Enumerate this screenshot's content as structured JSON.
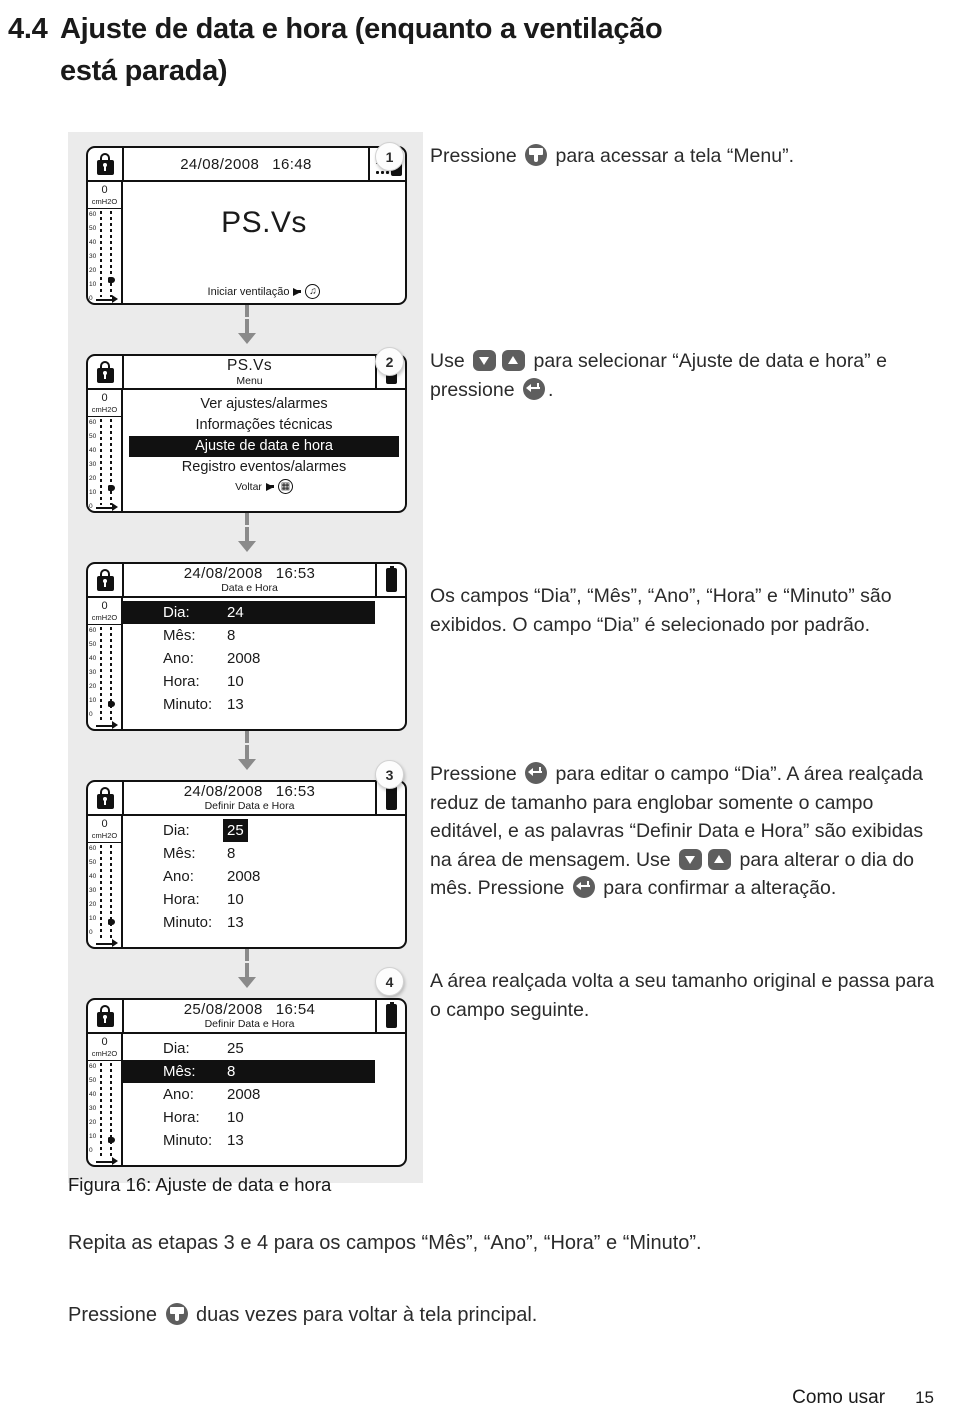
{
  "heading": {
    "section_number": "4.4",
    "line1": "Ajuste de data e hora (enquanto a ventilação",
    "line2": "está parada)"
  },
  "device_common": {
    "lock_icon": "lock-icon",
    "scale_zero": "0",
    "scale_unit": "cmH2O",
    "scale_ticks": [
      "60",
      "50",
      "40",
      "30",
      "20",
      "10",
      "0"
    ],
    "battery_icon": "battery-icon",
    "alarm_icon": "alarm-silence-icon"
  },
  "screens": [
    {
      "id": "screen-home",
      "header_datetime": "24/08/2008",
      "header_time": "16:48",
      "mode_label": "PS.Vs",
      "footer_hint": "Iniciar ventilação",
      "footer_icon": "start-ventilation-icon"
    },
    {
      "id": "screen-menu",
      "title": "PS.Vs",
      "subtitle": "Menu",
      "items": [
        {
          "label": "Ver ajustes/alarmes",
          "selected": false
        },
        {
          "label": "Informações técnicas",
          "selected": false
        },
        {
          "label": "Ajuste de data e hora",
          "selected": true
        },
        {
          "label": "Registro eventos/alarmes",
          "selected": false
        }
      ],
      "footer_hint": "Voltar",
      "footer_icon": "menu-key-icon"
    },
    {
      "id": "screen-data-hora",
      "header_datetime": "24/08/2008",
      "header_time": "16:53",
      "subtitle": "Data e Hora",
      "fields": [
        {
          "label": "Dia:",
          "value": "24",
          "highlight": "row"
        },
        {
          "label": "Mês:",
          "value": "8",
          "highlight": "none"
        },
        {
          "label": "Ano:",
          "value": "2008",
          "highlight": "none"
        },
        {
          "label": "Hora:",
          "value": "10",
          "highlight": "none"
        },
        {
          "label": "Minuto:",
          "value": "13",
          "highlight": "none"
        }
      ]
    },
    {
      "id": "screen-definir-dia",
      "header_datetime": "24/08/2008",
      "header_time": "16:53",
      "subtitle": "Definir Data e Hora",
      "fields": [
        {
          "label": "Dia:",
          "value": "25",
          "highlight": "value"
        },
        {
          "label": "Mês:",
          "value": "8",
          "highlight": "none"
        },
        {
          "label": "Ano:",
          "value": "2008",
          "highlight": "none"
        },
        {
          "label": "Hora:",
          "value": "10",
          "highlight": "none"
        },
        {
          "label": "Minuto:",
          "value": "13",
          "highlight": "none"
        }
      ]
    },
    {
      "id": "screen-definir-mes",
      "header_datetime": "25/08/2008",
      "header_time": "16:54",
      "subtitle": "Definir Data e Hora",
      "fields": [
        {
          "label": "Dia:",
          "value": "25",
          "highlight": "none"
        },
        {
          "label": "Mês:",
          "value": "8",
          "highlight": "row"
        },
        {
          "label": "Ano:",
          "value": "2008",
          "highlight": "none"
        },
        {
          "label": "Hora:",
          "value": "10",
          "highlight": "none"
        },
        {
          "label": "Minuto:",
          "value": "13",
          "highlight": "none"
        }
      ]
    }
  ],
  "steps": [
    {
      "number": "1",
      "parts": [
        {
          "t": "text",
          "v": "Pressione "
        },
        {
          "t": "icon",
          "v": "book-key-icon"
        },
        {
          "t": "text",
          "v": " para acessar a tela “Menu”."
        }
      ]
    },
    {
      "number": "2",
      "parts": [
        {
          "t": "text",
          "v": "Use "
        },
        {
          "t": "icon",
          "v": "arrow-down-key-icon"
        },
        {
          "t": "icon",
          "v": "arrow-up-key-icon"
        },
        {
          "t": "text",
          "v": " para selecionar “Ajuste de data e hora” e pressione "
        },
        {
          "t": "icon",
          "v": "enter-key-icon"
        },
        {
          "t": "text",
          "v": "."
        }
      ]
    },
    {
      "number": "",
      "parts": [
        {
          "t": "text",
          "v": "Os campos “Dia”, “Mês”, “Ano”, “Hora” e “Minuto” são exibidos. O campo “Dia” é selecionado por padrão."
        }
      ]
    },
    {
      "number": "3",
      "parts": [
        {
          "t": "text",
          "v": "Pressione "
        },
        {
          "t": "icon",
          "v": "enter-key-icon"
        },
        {
          "t": "text",
          "v": " para editar o campo “Dia”. A área realçada reduz de tamanho para englobar somente o campo editável, e as palavras “Definir Data e Hora” são exibidas na área de mensagem. Use "
        },
        {
          "t": "icon",
          "v": "arrow-down-key-icon"
        },
        {
          "t": "icon",
          "v": "arrow-up-key-icon"
        },
        {
          "t": "text",
          "v": " para alterar o dia do mês. Pressione "
        },
        {
          "t": "icon",
          "v": "enter-key-icon"
        },
        {
          "t": "text",
          "v": " para confirmar a alteração."
        }
      ]
    },
    {
      "number": "4",
      "parts": [
        {
          "t": "text",
          "v": "A área realçada volta a seu tamanho original e passa para o campo seguinte."
        }
      ]
    }
  ],
  "caption": "Figura 16: Ajuste de data e hora",
  "paragraphs": [
    {
      "parts": [
        {
          "t": "text",
          "v": "Repita as etapas 3 e 4 para os campos “Mês”, “Ano”, “Hora” e “Minuto”."
        }
      ]
    },
    {
      "parts": [
        {
          "t": "text",
          "v": "Pressione "
        },
        {
          "t": "icon",
          "v": "book-key-icon"
        },
        {
          "t": "text",
          "v": " duas vezes para voltar à tela principal."
        }
      ]
    }
  ],
  "footer": {
    "chapter": "Como usar",
    "page_number": "15"
  }
}
